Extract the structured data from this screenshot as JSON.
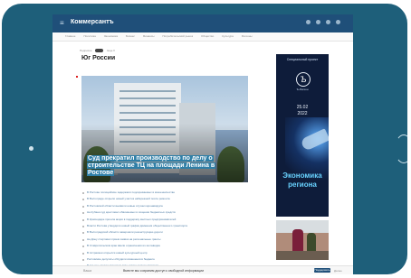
{
  "app": {
    "logo": "Коммерсантъ"
  },
  "nav": {
    "items": [
      "Главное",
      "Политика",
      "Экономика",
      "Бизнес",
      "Финансы",
      "Потребительский рынок",
      "Общество",
      "Культура",
      "Регионы"
    ]
  },
  "breadcrumbs": {
    "left": "Подписка",
    "right": "Еще ▾"
  },
  "page": {
    "title": "Юг России"
  },
  "hero": {
    "headline": "Суд прекратил производство по делу о строительстве ТЦ на площади Ленина в Ростове"
  },
  "news": {
    "items": [
      "В Ростове полицейские задержали подозреваемых в мошенничестве",
      "В Волгограде открыли новый участок набережной после ремонта",
      "В Ростовской области выявили новые случаи коронавируса",
      "На Кубани суд арестовал обвиняемых в хищении бюджетных средств",
      "В Краснодаре прошла акция в поддержку местных предпринимателей",
      "Власти Ростова утвердили новый график движения общественного транспорта",
      "В Волгоградской области завершили реконструкцию дороги",
      "На Дону стартовал прием заявок на региональные гранты",
      "В Ставропольском крае ввели ограничения из-за паводка",
      "В Астрахани открылся новый культурный центр",
      "Ростовские депутаты обсудили изменения в бюджете",
      "В Адыгее начали строительство нового жилого квартала"
    ]
  },
  "ad": {
    "top": "Специальный проект",
    "logo_letter": "Ъ",
    "logo_caption": "Ъ-Регион",
    "date": "25.02",
    "year": "2022",
    "title_line1": "Экономика",
    "title_line2": "региона"
  },
  "bottombar": {
    "label": "Ваша",
    "message": "Вместе мы сохраним доступ к свободной информации",
    "button": "Поддержать",
    "more": "Далее"
  },
  "colors": {
    "frame": "#1e5f7a",
    "topbar": "#1f4f79",
    "link": "#4a7aa3",
    "ad_title": "#68d2ff"
  }
}
